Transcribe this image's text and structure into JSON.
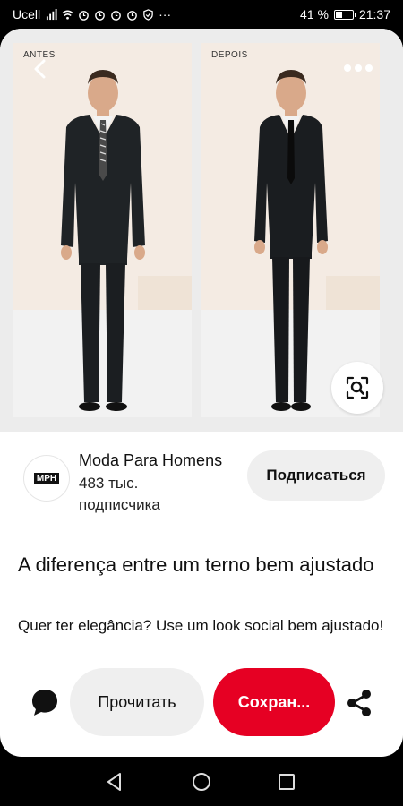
{
  "status_bar": {
    "carrier": "Ucell",
    "battery": "41 %",
    "time": "21:37",
    "battery_level": 0.41
  },
  "photo": {
    "before_label": "ANTES",
    "after_label": "DEPOIS"
  },
  "creator": {
    "avatar_text": "MPH",
    "name": "Moda Para Homens",
    "subscribers": "483 тыс. подписчика",
    "follow_label": "Подписаться"
  },
  "pin": {
    "title": "A diferença entre um terno bem ajustado",
    "description": "Quer ter elegância? Use um look social bem ajustado!"
  },
  "actions": {
    "read_label": "Прочитать",
    "save_label": "Сохран..."
  },
  "colors": {
    "accent": "#e60023",
    "button_bg": "#efefef"
  },
  "icons": {
    "back": "chevron-left-icon",
    "more": "more-dots-icon",
    "lens": "visual-search-icon",
    "comment": "comment-bubble-icon",
    "share": "share-icon"
  }
}
